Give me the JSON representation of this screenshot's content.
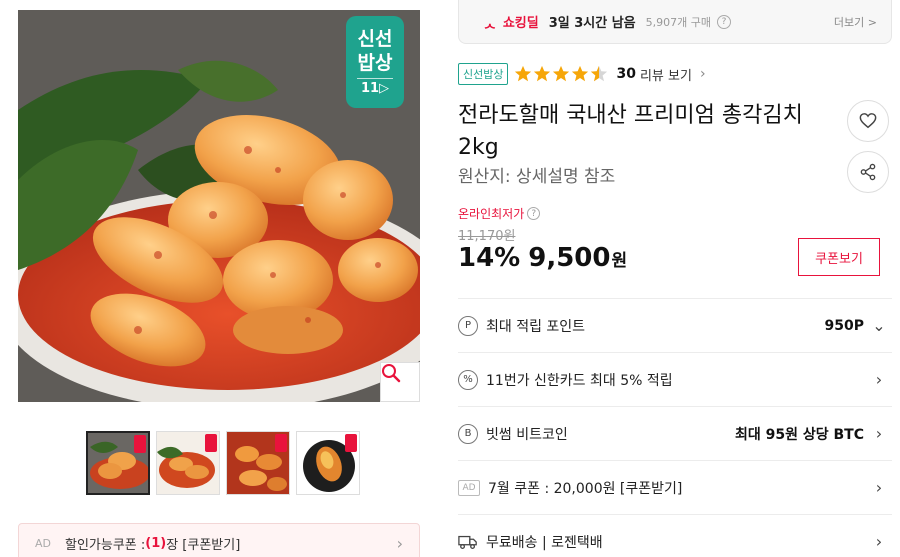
{
  "image": {
    "badge": {
      "line1": "신선",
      "line2": "밥상",
      "brand": "11▷"
    },
    "zoom_icon": "magnifier-icon",
    "thumbnails": [
      {
        "name": "thumb-1",
        "active": true
      },
      {
        "name": "thumb-2",
        "active": false
      },
      {
        "name": "thumb-3",
        "active": false
      },
      {
        "name": "thumb-4",
        "active": false
      }
    ]
  },
  "coupon_bar": {
    "ad": "AD",
    "label": "할인가능쿠폰 : ",
    "count": "(1)",
    "suffix": "장 [쿠폰받기]"
  },
  "deal": {
    "logo": "ᆺ",
    "name": "쇼킹딜",
    "time_left": "3일 3시간 남음",
    "bought": "5,907개 구매",
    "help": "?",
    "more": "더보기 >"
  },
  "rating": {
    "tag": "신선밥상",
    "stars": 4.5,
    "count": "30",
    "link": "리뷰 보기",
    "chevron": "›"
  },
  "product": {
    "title": "전라도할매 국내산 프리미엄 총각김치 2kg",
    "origin": "원산지: 상세설명 참조"
  },
  "price": {
    "label": "온라인최저가",
    "help": "?",
    "original": "11,170원",
    "discount": "14%",
    "sale": "9,500",
    "won": "원",
    "coupon_button": "쿠폰보기"
  },
  "benefits": [
    {
      "icon": "P",
      "label": "최대 적립 포인트",
      "value": "950P",
      "chevron": "⌄"
    },
    {
      "icon": "%",
      "label": "11번가 신한카드 최대 5% 적립",
      "value": "",
      "chevron": "›"
    },
    {
      "icon": "B",
      "label": "빗썸 비트코인",
      "value": "최대 95원 상당 BTC",
      "chevron": "›"
    },
    {
      "icon": "AD",
      "label": "7월 쿠폰 : 20,000원 [쿠폰받기]",
      "value": "",
      "chevron": "›"
    },
    {
      "icon": "truck",
      "label": "무료배송 | 로젠택배",
      "value": "",
      "chevron": "›"
    }
  ],
  "colors": {
    "accent": "#e8133c",
    "fresh": "#1fa38e",
    "star": "#f6a609"
  }
}
